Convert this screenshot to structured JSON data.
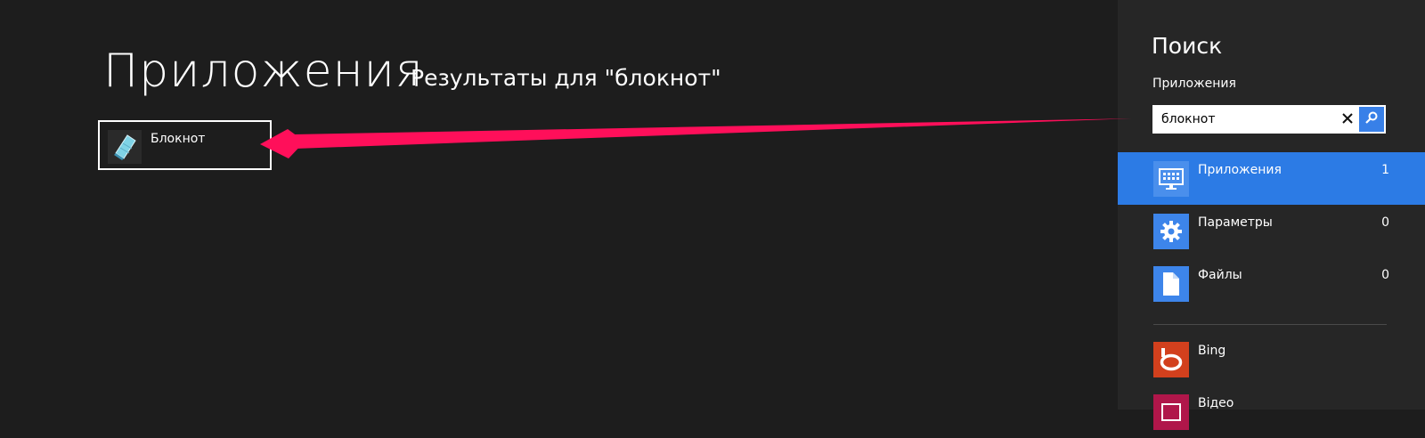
{
  "main": {
    "title": "Приложения",
    "subtitle": "Результаты для \"блокнот\"",
    "results": [
      {
        "label": "Блокнот",
        "icon": "notepad-icon"
      }
    ]
  },
  "annotation": {
    "arrow_color": "#ff0f5a"
  },
  "search_pane": {
    "title": "Поиск",
    "scope_label": "Приложения",
    "query": "блокнот",
    "clear_icon": "close-icon",
    "search_icon": "search-icon",
    "scopes": [
      {
        "label": "Приложения",
        "count": "1",
        "icon": "apps-icon",
        "selected": true
      },
      {
        "label": "Параметры",
        "count": "0",
        "icon": "gear-icon",
        "selected": false
      },
      {
        "label": "Файлы",
        "count": "0",
        "icon": "file-icon",
        "selected": false
      }
    ],
    "apps": [
      {
        "label": "Bing",
        "icon": "bing-icon",
        "color": "#d2401d"
      },
      {
        "label": "Відео",
        "icon": "video-icon",
        "color": "#b0164a"
      }
    ]
  },
  "colors": {
    "background": "#1d1d1d",
    "pane_background": "#262626",
    "accent": "#2c7be5"
  }
}
